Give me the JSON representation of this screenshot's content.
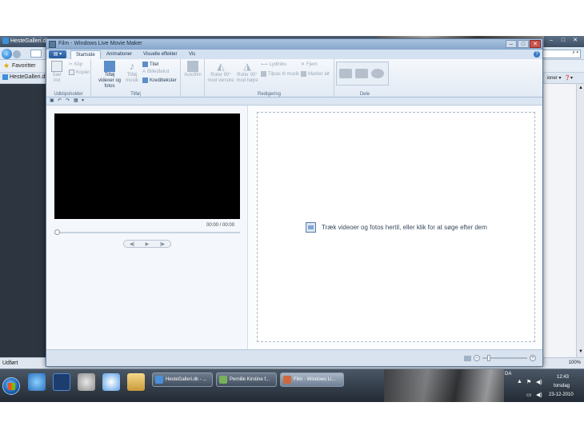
{
  "browser": {
    "title": "HesteGalleri.dk",
    "favorites_label": "Favoritter",
    "tab_label": "HesteGalleri.dk",
    "toolbar_fragment": "ioner ▾",
    "status_text": "Udført",
    "zoom_text": "100%"
  },
  "moviemaker": {
    "window_title": "Film - Windows Live Movie Maker",
    "tabs": [
      "Startside",
      "Animationer",
      "Visuelle effekter",
      "Vis"
    ],
    "active_tab": "Startside",
    "ribbon": {
      "clipboard": {
        "paste_label": "Sæt ind",
        "cut_label": "Klip",
        "copy_label": "Kopier",
        "group_label": "Udklipsholder"
      },
      "add": {
        "add_videos_label": "Tilføj videoer og fotos",
        "add_music_label": "Tilføj musik",
        "title_label": "Titel",
        "caption_label": "Billedtekst",
        "credits_label": "Kredittekster",
        "group_label": "Tilføj"
      },
      "automovie": {
        "label": "Autofilm"
      },
      "editing": {
        "rotate_left_label": "Roter 90° mod venstre",
        "rotate_right_label": "Roter 90° mod højre",
        "snapshot_label": "Lydmiks",
        "fit_music_label": "Tilpas til musik",
        "remove_label": "Fjern",
        "select_all_label": "Marker alt",
        "group_label": "Redigering"
      },
      "share": {
        "group_label": "Dele"
      }
    },
    "preview": {
      "time_display": "00:00 / 00:00"
    },
    "storyboard": {
      "hint": "Træk videoer og fotos hertil, eller klik for at søge efter dem"
    }
  },
  "taskbar": {
    "tasks": [
      {
        "label": "HesteGalleri.dk - ..."
      },
      {
        "label": "Pernille Kirstine f..."
      },
      {
        "label": "Film - Windows Li..."
      }
    ],
    "tray": {
      "language": "DA",
      "time": "12:43",
      "day": "torsdag",
      "date": "23-12-2010"
    }
  }
}
